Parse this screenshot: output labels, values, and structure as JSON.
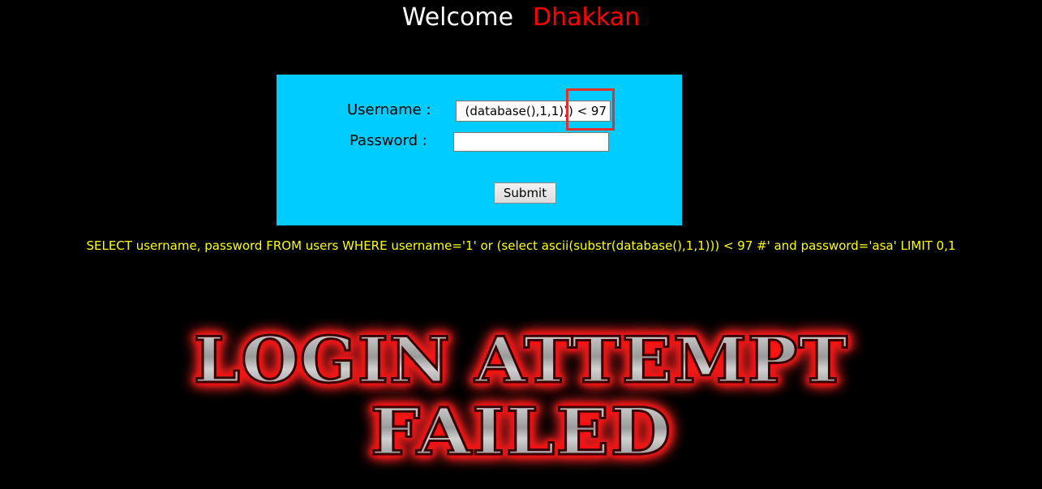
{
  "header": {
    "welcome_label": "Welcome",
    "user_name": "Dhakkan"
  },
  "login_form": {
    "username_label": "Username :",
    "username_value": "(database(),1,1))) < 97",
    "password_label": "Password :",
    "password_value": "",
    "submit_label": "Submit"
  },
  "query_text": "SELECT username, password FROM users WHERE username='1' or (select ascii(substr(database(),1,1))) < 97 #' and password='asa' LIMIT 0,1",
  "result_banner": {
    "line1": "LOGIN ATTEMPT",
    "line2": "FAILED"
  },
  "colors": {
    "background": "#000000",
    "form_background": "#00ccff",
    "user_name": "#ff0000",
    "query": "#ffff00",
    "highlight": "#e0312f"
  }
}
